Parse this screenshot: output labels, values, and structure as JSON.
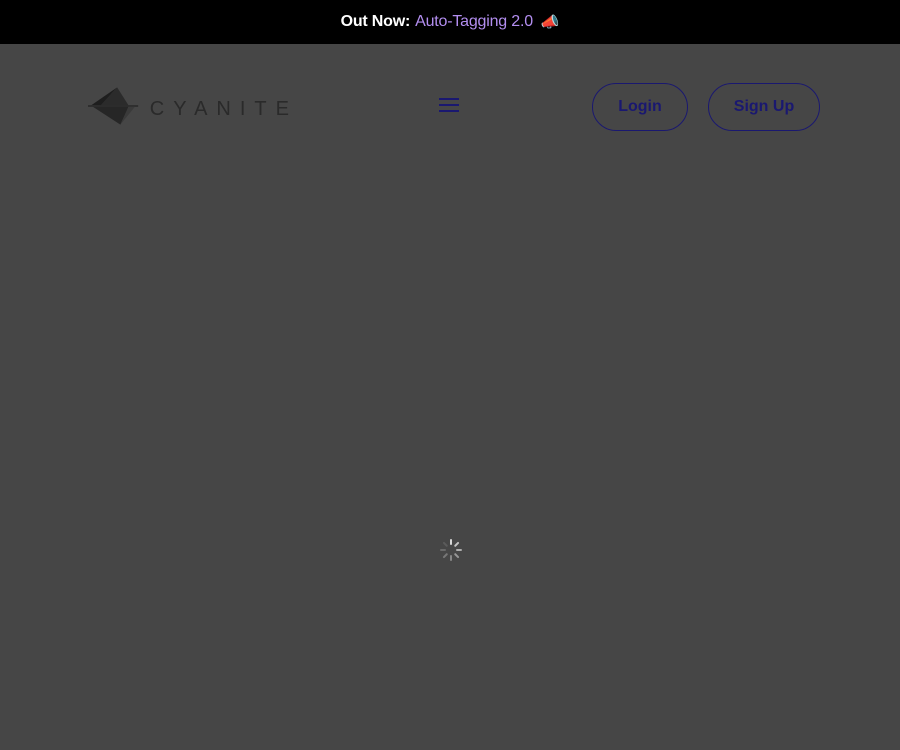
{
  "announcement": {
    "lead": "Out Now:",
    "link": "Auto-Tagging 2.0",
    "emoji": "📣"
  },
  "header": {
    "brand": "CYANITE",
    "menu_icon": "hamburger-icon",
    "login_label": "Login",
    "signup_label": "Sign Up"
  },
  "status": {
    "loading_icon": "loading-spinner-icon"
  },
  "colors": {
    "background": "#464646",
    "banner": "#000000",
    "accent_link": "#b38ef0",
    "button_outline": "#1a1870"
  }
}
